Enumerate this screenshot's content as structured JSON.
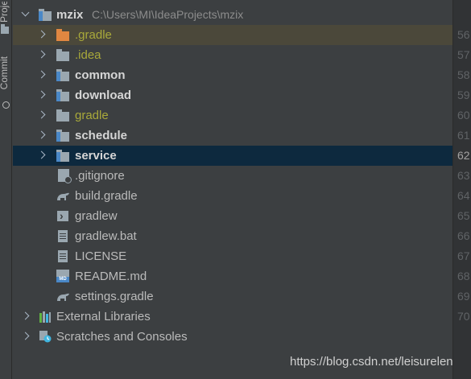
{
  "left_strip": {
    "project_label": "Project",
    "commit_label": "Commit"
  },
  "tree": {
    "root": {
      "name": "mzix",
      "path": "C:\\Users\\MI\\IdeaProjects\\mzix"
    },
    "folders": [
      {
        "name": ".gradle",
        "style": "orange"
      },
      {
        "name": ".idea",
        "style": "plain"
      },
      {
        "name": "common",
        "style": "module"
      },
      {
        "name": "download",
        "style": "module"
      },
      {
        "name": "gradle",
        "style": "plain"
      },
      {
        "name": "schedule",
        "style": "module"
      },
      {
        "name": "service",
        "style": "module"
      }
    ],
    "files": [
      {
        "name": ".gitignore",
        "icon": "gitignore-icon"
      },
      {
        "name": "build.gradle",
        "icon": "gradle-icon"
      },
      {
        "name": "gradlew",
        "icon": "terminal-file-icon"
      },
      {
        "name": "gradlew.bat",
        "icon": "text-file-icon"
      },
      {
        "name": "LICENSE",
        "icon": "text-file-icon"
      },
      {
        "name": "README.md",
        "icon": "markdown-icon"
      },
      {
        "name": "settings.gradle",
        "icon": "gradle-icon"
      }
    ],
    "external_libraries": "External Libraries",
    "scratches": "Scratches and Consoles"
  },
  "gutter": {
    "line_numbers": [
      "56",
      "57",
      "58",
      "59",
      "60",
      "61",
      "62",
      "63",
      "64",
      "65",
      "66",
      "67",
      "68",
      "69",
      "70"
    ],
    "current_line": "62"
  },
  "watermark": "https://blog.csdn.net/leisurelen",
  "colors": {
    "background": "#3c3f41",
    "selection": "#0d293e",
    "highlight": "#4b483a",
    "excluded_folder": "#e08741",
    "olive_text": "#a9a93a"
  }
}
